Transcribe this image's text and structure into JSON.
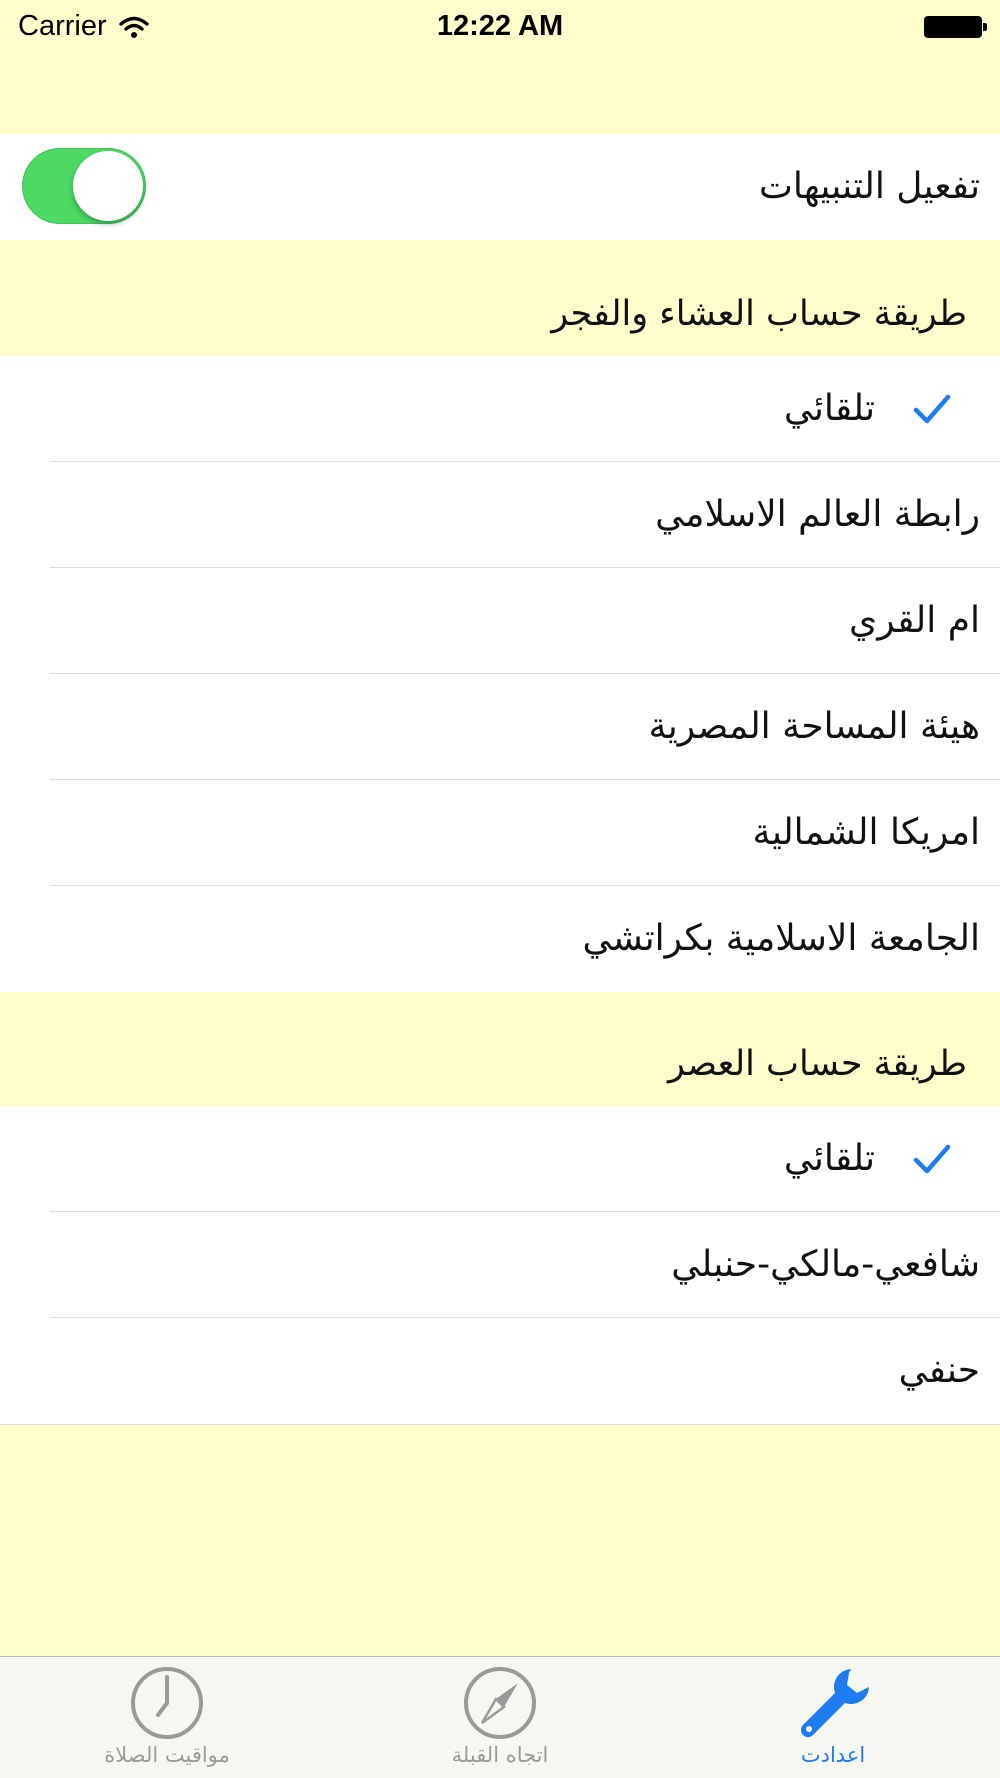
{
  "status_bar": {
    "carrier": "Carrier",
    "time": "12:22 AM"
  },
  "notifications": {
    "label": "تفعيل التنبيهات",
    "enabled": true
  },
  "isha_fajr_section": {
    "header": "طريقة حساب العشاء والفجر",
    "options": [
      {
        "label": "تلقائي",
        "selected": true
      },
      {
        "label": "رابطة العالم الاسلامي",
        "selected": false
      },
      {
        "label": "ام القري",
        "selected": false
      },
      {
        "label": "هيئة المساحة المصرية",
        "selected": false
      },
      {
        "label": "امريكا الشمالية",
        "selected": false
      },
      {
        "label": "الجامعة الاسلامية بكراتشي",
        "selected": false
      }
    ]
  },
  "asr_section": {
    "header": "طريقة حساب العصر",
    "options": [
      {
        "label": "تلقائي",
        "selected": true
      },
      {
        "label": "شافعي-مالكي-حنبلي",
        "selected": false
      },
      {
        "label": "حنفي",
        "selected": false
      }
    ]
  },
  "tab_bar": {
    "tabs": [
      {
        "label": "مواقيت الصلاة",
        "icon": "clock-icon",
        "active": false
      },
      {
        "label": "اتجاه القبلة",
        "icon": "compass-icon",
        "active": false
      },
      {
        "label": "اعدادت",
        "icon": "wrench-icon",
        "active": true
      }
    ]
  },
  "colors": {
    "background": "#fffdcc",
    "toggle_on": "#4cd964",
    "accent": "#1e7cf0"
  }
}
